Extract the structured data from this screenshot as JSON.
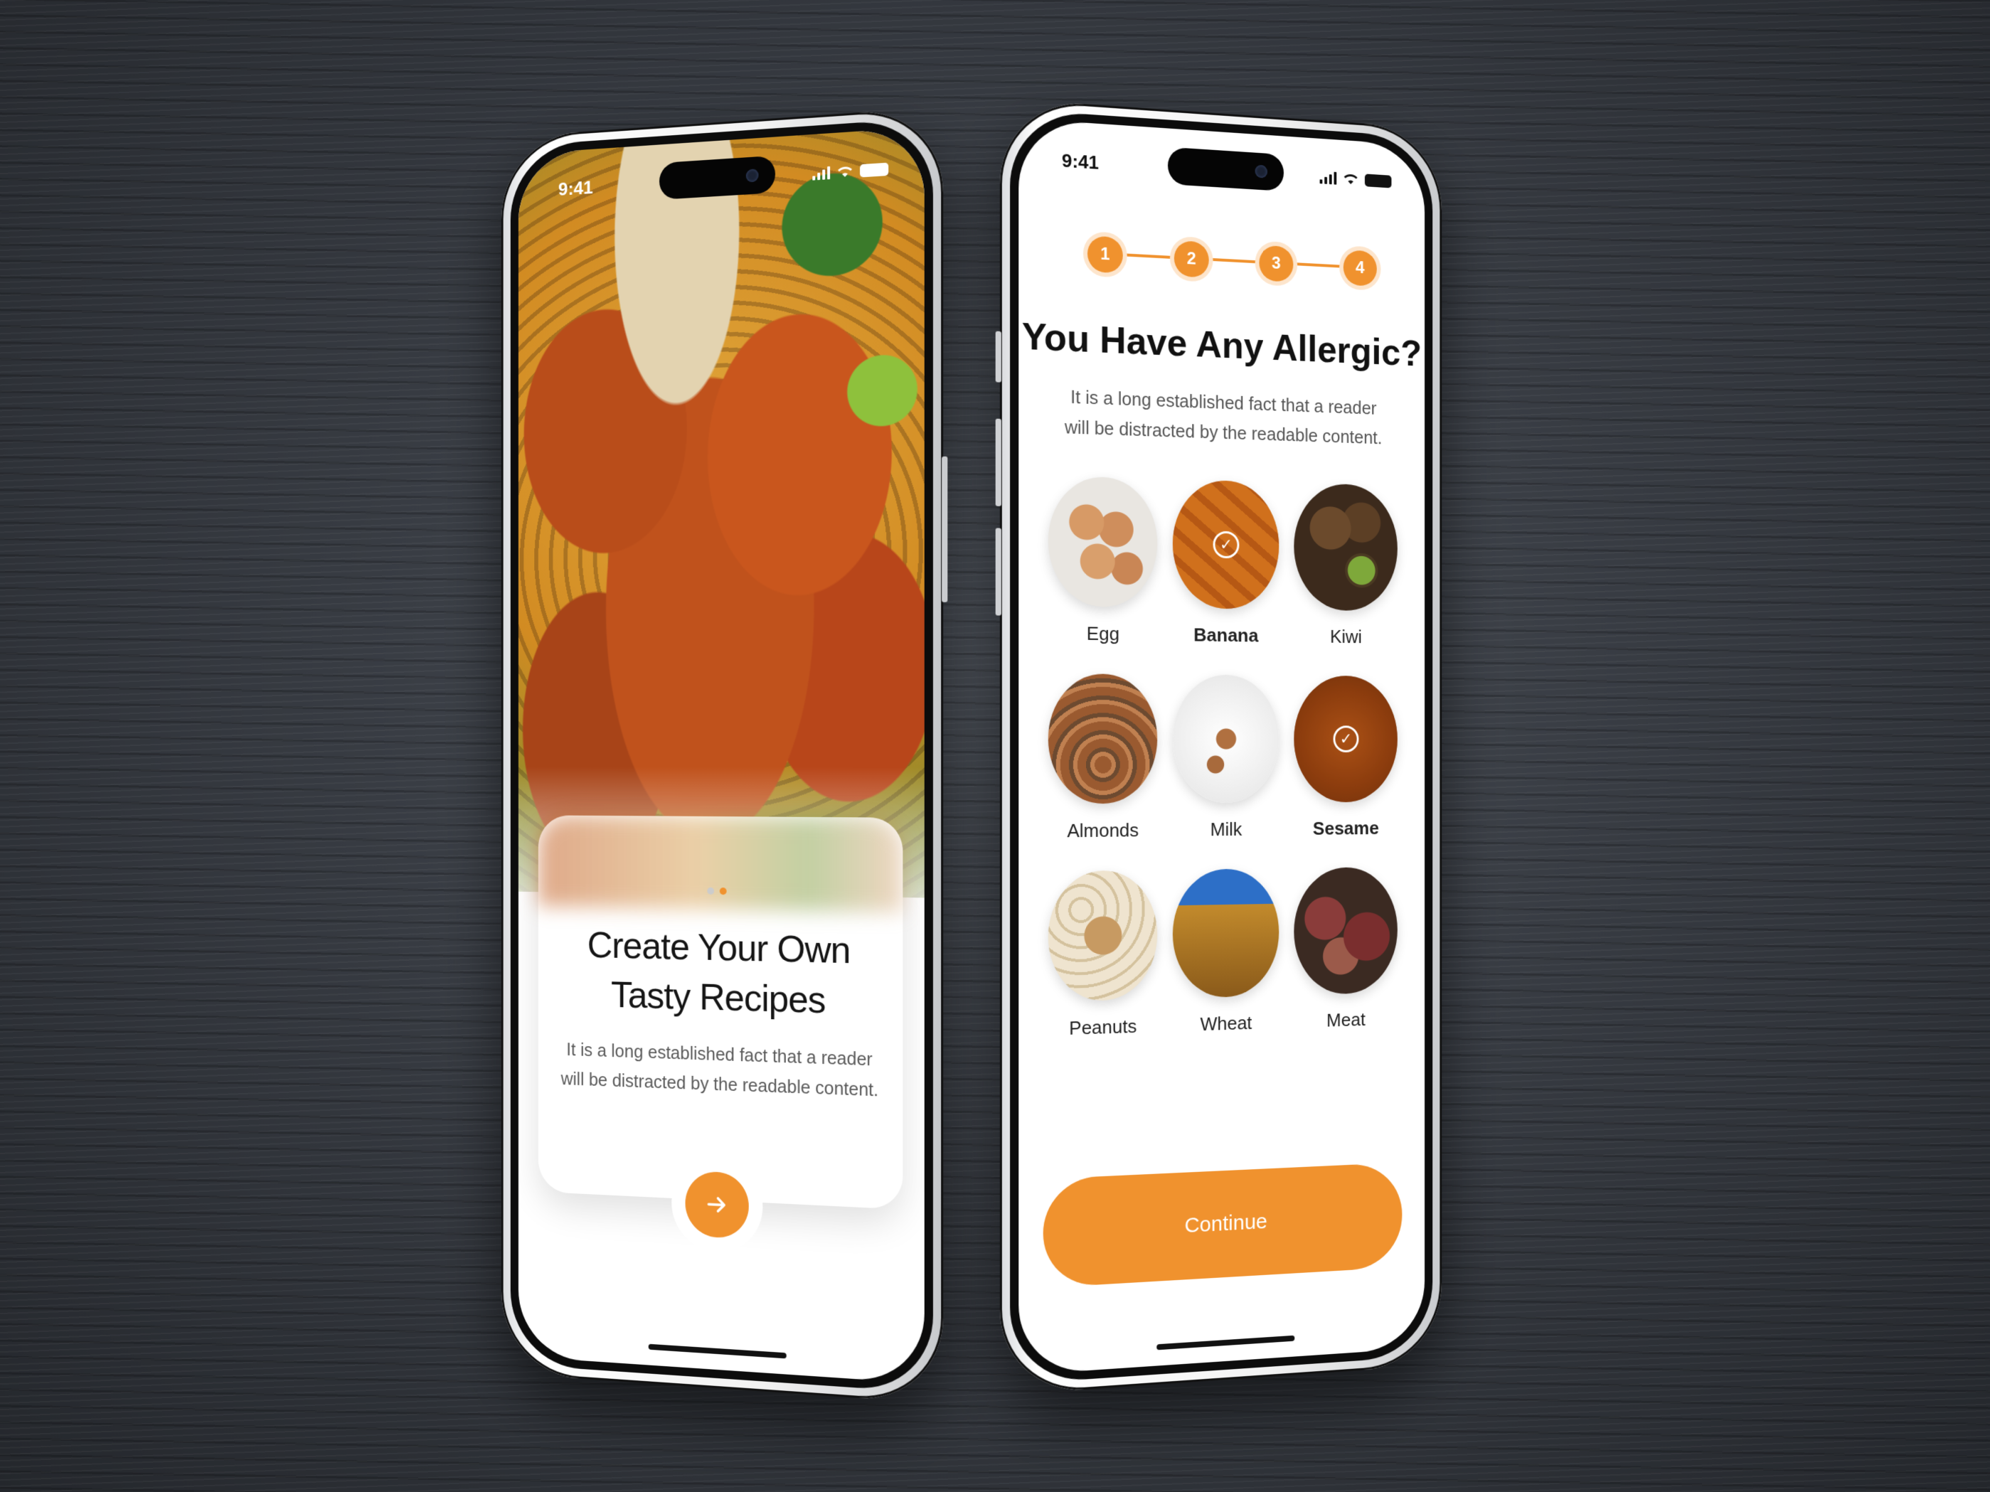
{
  "left_phone": {
    "time": "9:41",
    "title_line1": "Create Your Own",
    "title_line2": "Tasty Recipes",
    "subtitle_line1": "It is a long established fact that a reader",
    "subtitle_line2": "will be distracted by the readable content.",
    "next_icon": "arrow-right-icon"
  },
  "right_phone": {
    "time": "9:41",
    "steps": [
      "1",
      "2",
      "3",
      "4"
    ],
    "title": "You Have Any Allergic?",
    "subtitle_line1": "It is a long established fact that a reader",
    "subtitle_line2": "will be distracted by the readable content.",
    "foods": [
      {
        "label": "Egg",
        "selected": false
      },
      {
        "label": "Banana",
        "selected": true
      },
      {
        "label": "Kiwi",
        "selected": false
      },
      {
        "label": "Almonds",
        "selected": false
      },
      {
        "label": "Milk",
        "selected": false
      },
      {
        "label": "Sesame",
        "selected": true
      },
      {
        "label": "Peanuts",
        "selected": false
      },
      {
        "label": "Wheat",
        "selected": false
      },
      {
        "label": "Meat",
        "selected": false
      }
    ],
    "continue_label": "Continue"
  },
  "colors": {
    "accent": "#f0922e",
    "text": "#151515",
    "muted": "#5a5a5a"
  }
}
